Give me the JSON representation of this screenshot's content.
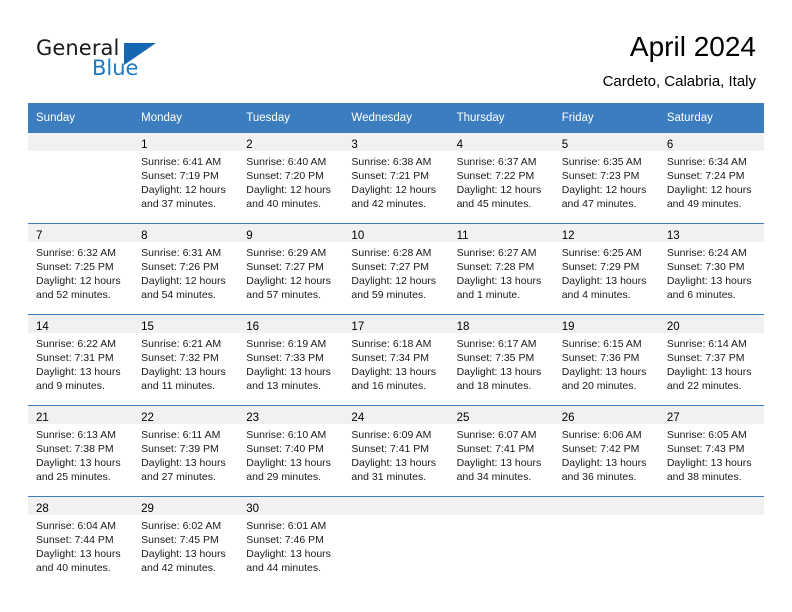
{
  "brand": {
    "name_part1": "General",
    "name_part2": "Blue",
    "logo_icon": "triangle-logo-icon",
    "accent_color": "#1567b2"
  },
  "header": {
    "title": "April 2024",
    "subtitle": "Cardeto, Calabria, Italy"
  },
  "colors": {
    "header_blue": "#3c7dbf",
    "daynum_band": "#f1f1f1",
    "brand_blue": "#2079c3",
    "text": "#1a1a1a"
  },
  "calendar": {
    "weekday_headers": [
      "Sunday",
      "Monday",
      "Tuesday",
      "Wednesday",
      "Thursday",
      "Friday",
      "Saturday"
    ],
    "weeks": [
      [
        {
          "day": "",
          "sunrise": "",
          "sunset": "",
          "daylight_line1": "",
          "daylight_line2": ""
        },
        {
          "day": "1",
          "sunrise": "Sunrise: 6:41 AM",
          "sunset": "Sunset: 7:19 PM",
          "daylight_line1": "Daylight: 12 hours",
          "daylight_line2": "and 37 minutes."
        },
        {
          "day": "2",
          "sunrise": "Sunrise: 6:40 AM",
          "sunset": "Sunset: 7:20 PM",
          "daylight_line1": "Daylight: 12 hours",
          "daylight_line2": "and 40 minutes."
        },
        {
          "day": "3",
          "sunrise": "Sunrise: 6:38 AM",
          "sunset": "Sunset: 7:21 PM",
          "daylight_line1": "Daylight: 12 hours",
          "daylight_line2": "and 42 minutes."
        },
        {
          "day": "4",
          "sunrise": "Sunrise: 6:37 AM",
          "sunset": "Sunset: 7:22 PM",
          "daylight_line1": "Daylight: 12 hours",
          "daylight_line2": "and 45 minutes."
        },
        {
          "day": "5",
          "sunrise": "Sunrise: 6:35 AM",
          "sunset": "Sunset: 7:23 PM",
          "daylight_line1": "Daylight: 12 hours",
          "daylight_line2": "and 47 minutes."
        },
        {
          "day": "6",
          "sunrise": "Sunrise: 6:34 AM",
          "sunset": "Sunset: 7:24 PM",
          "daylight_line1": "Daylight: 12 hours",
          "daylight_line2": "and 49 minutes."
        }
      ],
      [
        {
          "day": "7",
          "sunrise": "Sunrise: 6:32 AM",
          "sunset": "Sunset: 7:25 PM",
          "daylight_line1": "Daylight: 12 hours",
          "daylight_line2": "and 52 minutes."
        },
        {
          "day": "8",
          "sunrise": "Sunrise: 6:31 AM",
          "sunset": "Sunset: 7:26 PM",
          "daylight_line1": "Daylight: 12 hours",
          "daylight_line2": "and 54 minutes."
        },
        {
          "day": "9",
          "sunrise": "Sunrise: 6:29 AM",
          "sunset": "Sunset: 7:27 PM",
          "daylight_line1": "Daylight: 12 hours",
          "daylight_line2": "and 57 minutes."
        },
        {
          "day": "10",
          "sunrise": "Sunrise: 6:28 AM",
          "sunset": "Sunset: 7:27 PM",
          "daylight_line1": "Daylight: 12 hours",
          "daylight_line2": "and 59 minutes."
        },
        {
          "day": "11",
          "sunrise": "Sunrise: 6:27 AM",
          "sunset": "Sunset: 7:28 PM",
          "daylight_line1": "Daylight: 13 hours",
          "daylight_line2": "and 1 minute."
        },
        {
          "day": "12",
          "sunrise": "Sunrise: 6:25 AM",
          "sunset": "Sunset: 7:29 PM",
          "daylight_line1": "Daylight: 13 hours",
          "daylight_line2": "and 4 minutes."
        },
        {
          "day": "13",
          "sunrise": "Sunrise: 6:24 AM",
          "sunset": "Sunset: 7:30 PM",
          "daylight_line1": "Daylight: 13 hours",
          "daylight_line2": "and 6 minutes."
        }
      ],
      [
        {
          "day": "14",
          "sunrise": "Sunrise: 6:22 AM",
          "sunset": "Sunset: 7:31 PM",
          "daylight_line1": "Daylight: 13 hours",
          "daylight_line2": "and 9 minutes."
        },
        {
          "day": "15",
          "sunrise": "Sunrise: 6:21 AM",
          "sunset": "Sunset: 7:32 PM",
          "daylight_line1": "Daylight: 13 hours",
          "daylight_line2": "and 11 minutes."
        },
        {
          "day": "16",
          "sunrise": "Sunrise: 6:19 AM",
          "sunset": "Sunset: 7:33 PM",
          "daylight_line1": "Daylight: 13 hours",
          "daylight_line2": "and 13 minutes."
        },
        {
          "day": "17",
          "sunrise": "Sunrise: 6:18 AM",
          "sunset": "Sunset: 7:34 PM",
          "daylight_line1": "Daylight: 13 hours",
          "daylight_line2": "and 16 minutes."
        },
        {
          "day": "18",
          "sunrise": "Sunrise: 6:17 AM",
          "sunset": "Sunset: 7:35 PM",
          "daylight_line1": "Daylight: 13 hours",
          "daylight_line2": "and 18 minutes."
        },
        {
          "day": "19",
          "sunrise": "Sunrise: 6:15 AM",
          "sunset": "Sunset: 7:36 PM",
          "daylight_line1": "Daylight: 13 hours",
          "daylight_line2": "and 20 minutes."
        },
        {
          "day": "20",
          "sunrise": "Sunrise: 6:14 AM",
          "sunset": "Sunset: 7:37 PM",
          "daylight_line1": "Daylight: 13 hours",
          "daylight_line2": "and 22 minutes."
        }
      ],
      [
        {
          "day": "21",
          "sunrise": "Sunrise: 6:13 AM",
          "sunset": "Sunset: 7:38 PM",
          "daylight_line1": "Daylight: 13 hours",
          "daylight_line2": "and 25 minutes."
        },
        {
          "day": "22",
          "sunrise": "Sunrise: 6:11 AM",
          "sunset": "Sunset: 7:39 PM",
          "daylight_line1": "Daylight: 13 hours",
          "daylight_line2": "and 27 minutes."
        },
        {
          "day": "23",
          "sunrise": "Sunrise: 6:10 AM",
          "sunset": "Sunset: 7:40 PM",
          "daylight_line1": "Daylight: 13 hours",
          "daylight_line2": "and 29 minutes."
        },
        {
          "day": "24",
          "sunrise": "Sunrise: 6:09 AM",
          "sunset": "Sunset: 7:41 PM",
          "daylight_line1": "Daylight: 13 hours",
          "daylight_line2": "and 31 minutes."
        },
        {
          "day": "25",
          "sunrise": "Sunrise: 6:07 AM",
          "sunset": "Sunset: 7:41 PM",
          "daylight_line1": "Daylight: 13 hours",
          "daylight_line2": "and 34 minutes."
        },
        {
          "day": "26",
          "sunrise": "Sunrise: 6:06 AM",
          "sunset": "Sunset: 7:42 PM",
          "daylight_line1": "Daylight: 13 hours",
          "daylight_line2": "and 36 minutes."
        },
        {
          "day": "27",
          "sunrise": "Sunrise: 6:05 AM",
          "sunset": "Sunset: 7:43 PM",
          "daylight_line1": "Daylight: 13 hours",
          "daylight_line2": "and 38 minutes."
        }
      ],
      [
        {
          "day": "28",
          "sunrise": "Sunrise: 6:04 AM",
          "sunset": "Sunset: 7:44 PM",
          "daylight_line1": "Daylight: 13 hours",
          "daylight_line2": "and 40 minutes."
        },
        {
          "day": "29",
          "sunrise": "Sunrise: 6:02 AM",
          "sunset": "Sunset: 7:45 PM",
          "daylight_line1": "Daylight: 13 hours",
          "daylight_line2": "and 42 minutes."
        },
        {
          "day": "30",
          "sunrise": "Sunrise: 6:01 AM",
          "sunset": "Sunset: 7:46 PM",
          "daylight_line1": "Daylight: 13 hours",
          "daylight_line2": "and 44 minutes."
        },
        {
          "day": "",
          "sunrise": "",
          "sunset": "",
          "daylight_line1": "",
          "daylight_line2": ""
        },
        {
          "day": "",
          "sunrise": "",
          "sunset": "",
          "daylight_line1": "",
          "daylight_line2": ""
        },
        {
          "day": "",
          "sunrise": "",
          "sunset": "",
          "daylight_line1": "",
          "daylight_line2": ""
        },
        {
          "day": "",
          "sunrise": "",
          "sunset": "",
          "daylight_line1": "",
          "daylight_line2": ""
        }
      ]
    ]
  }
}
